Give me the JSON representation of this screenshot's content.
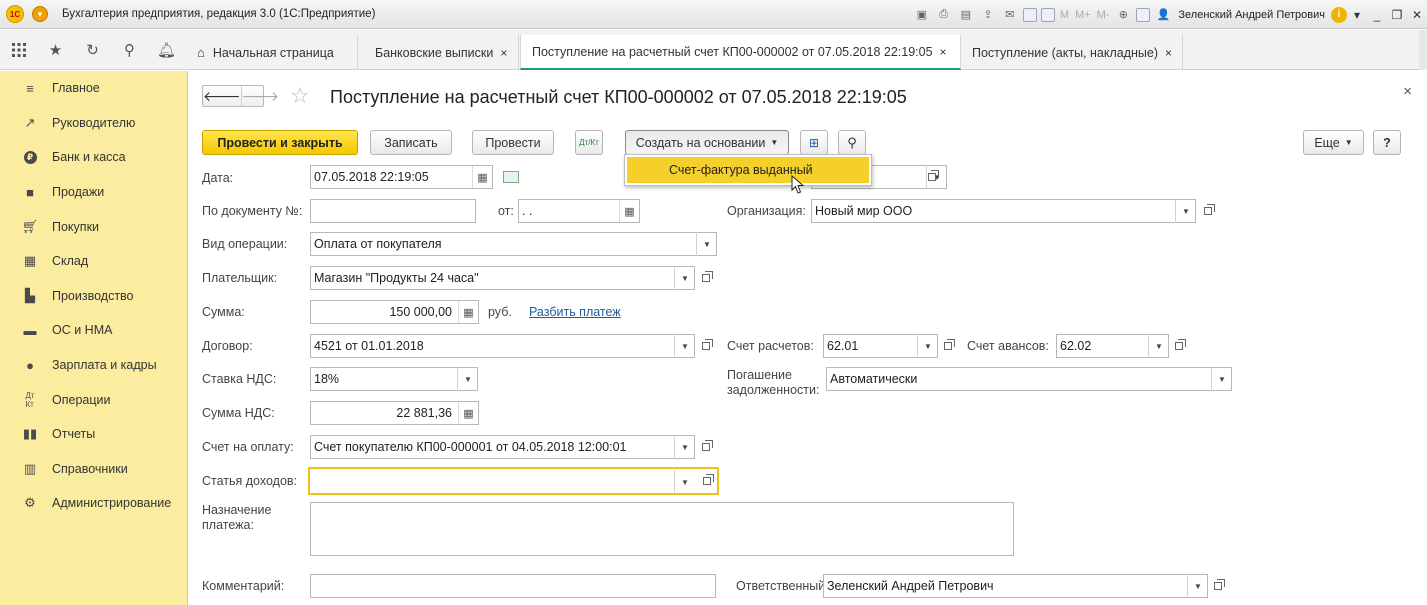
{
  "app": {
    "logo_text": "1С",
    "title": "Бухгалтерия предприятия, редакция 3.0  (1С:Предприятие)",
    "memory_buttons": [
      "M",
      "M+",
      "M-"
    ],
    "user": "Зеленский Андрей Петрович",
    "controls": {
      "minimize": "_",
      "restore": "❐",
      "close": "✕"
    }
  },
  "tabs": [
    {
      "label": "Начальная страница",
      "icon": "home-icon"
    },
    {
      "label": "Банковские выписки",
      "close": "×"
    },
    {
      "label": "Поступление на расчетный счет КП00-000002 от 07.05.2018 22:19:05",
      "close": "×",
      "active": true
    },
    {
      "label": "Поступление (акты, накладные)",
      "close": "×"
    }
  ],
  "sidebar": {
    "items": [
      {
        "label": "Главное",
        "icon": "menu-lines-icon"
      },
      {
        "label": "Руководителю",
        "icon": "trend-icon"
      },
      {
        "label": "Банк и касса",
        "icon": "ruble-coin-icon"
      },
      {
        "label": "Продажи",
        "icon": "shopping-bag-icon"
      },
      {
        "label": "Покупки",
        "icon": "cart-icon"
      },
      {
        "label": "Склад",
        "icon": "warehouse-icon"
      },
      {
        "label": "Производство",
        "icon": "factory-icon"
      },
      {
        "label": "ОС и НМА",
        "icon": "truck-icon"
      },
      {
        "label": "Зарплата и кадры",
        "icon": "person-icon"
      },
      {
        "label": "Операции",
        "icon": "dt-kt-icon"
      },
      {
        "label": "Отчеты",
        "icon": "bar-chart-icon"
      },
      {
        "label": "Справочники",
        "icon": "books-icon"
      },
      {
        "label": "Администрирование",
        "icon": "gear-icon"
      }
    ]
  },
  "form": {
    "title": "Поступление на расчетный счет КП00-000002 от 07.05.2018 22:19:05",
    "close": "×",
    "nav_back": "🡐",
    "nav_forward": "🡒",
    "star": "☆",
    "toolbar": {
      "post_close": "Провести и закрыть",
      "save": "Записать",
      "post": "Провести",
      "dtkt": "Дт/Кт",
      "create_based": "Создать на основании",
      "more": "Еще",
      "help": "?"
    },
    "dropdown_menu": {
      "item": "Счет-фактура выданный"
    },
    "fields": {
      "date_label": "Дата:",
      "date_value": "07.05.2018 22:19:05",
      "doc_no_label": "По документу №:",
      "doc_no_value": "",
      "from_label": "от:",
      "from_value": " .  .",
      "op_label": "Вид операции:",
      "op_value": "Оплата от покупателя",
      "payer_label": "Плательщик:",
      "payer_value": "Магазин \"Продукты 24 часа\"",
      "sum_label": "Сумма:",
      "sum_value": "150 000,00",
      "currency": "руб.",
      "split_link": "Разбить платеж",
      "contract_label": "Договор:",
      "contract_value": "4521 от 01.01.2018",
      "vat_rate_label": "Ставка НДС:",
      "vat_rate_value": "18%",
      "vat_sum_label": "Сумма НДС:",
      "vat_sum_value": "22 881,36",
      "invoice_label": "Счет на оплату:",
      "invoice_value": "Счет покупателю КП00-000001 от 04.05.2018 12:00:01",
      "income_label": "Статья доходов:",
      "income_value": "",
      "purpose_label_1": "Назначение",
      "purpose_label_2": "платежа:",
      "purpose_value": "",
      "comment_label": "Комментарий:",
      "comment_value": "",
      "account_value_hidden": "",
      "org_label": "Организация:",
      "org_value": "Новый мир ООО",
      "settle_acc_label": "Счет расчетов:",
      "settle_acc_value": "62.01",
      "adv_acc_label": "Счет авансов:",
      "adv_acc_value": "62.02",
      "repay_label_1": "Погашение",
      "repay_label_2": "задолженности:",
      "repay_value": "Автоматически",
      "resp_label": "Ответственный:",
      "resp_value": "Зеленский Андрей Петрович"
    }
  },
  "colors": {
    "sidebar": "#fbeda0",
    "accent_yellow": "#f4c800",
    "active_tab_line": "#1a9e6b",
    "link": "#1c5a96"
  }
}
